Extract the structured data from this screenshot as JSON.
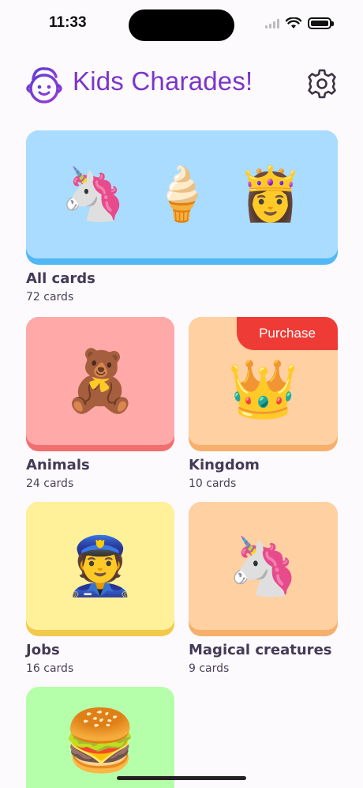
{
  "status_bar": {
    "time": "11:33",
    "icons": [
      "signal-icon",
      "wifi-icon",
      "battery-icon"
    ]
  },
  "header": {
    "title": "Kids Charades!",
    "logo_icon": "kid-face-logo-icon",
    "settings_icon": "gear-icon",
    "title_color": "#7b35c9"
  },
  "decks": [
    {
      "title": "All cards",
      "count": "72 cards",
      "emojis": [
        "🦄",
        "🍦",
        "👸"
      ],
      "bg": "#a9dcff",
      "shade": "#4fb8f5"
    },
    {
      "title": "Animals",
      "count": "24 cards",
      "emojis": [
        "🧸"
      ],
      "bg": "#ffa9a9",
      "shade": "#f26f6f"
    },
    {
      "title": "Kingdom",
      "count": "10 cards",
      "emojis": [
        "👑"
      ],
      "bg": "#ffd0a2",
      "shade": "#f6b06c",
      "badge": "Purchase",
      "badge_color": "#ef3b36"
    },
    {
      "title": "Jobs",
      "count": "16 cards",
      "emojis": [
        "👮"
      ],
      "bg": "#fff09a",
      "shade": "#f2c94a"
    },
    {
      "title": "Magical creatures",
      "count": "9 cards",
      "emojis": [
        "🦄"
      ],
      "bg": "#ffd0a2",
      "shade": "#f6b06c"
    },
    {
      "title": "",
      "count": "",
      "emojis": [
        "🍔"
      ],
      "bg": "#b6ffaa",
      "shade": "#7fdc6f"
    }
  ]
}
